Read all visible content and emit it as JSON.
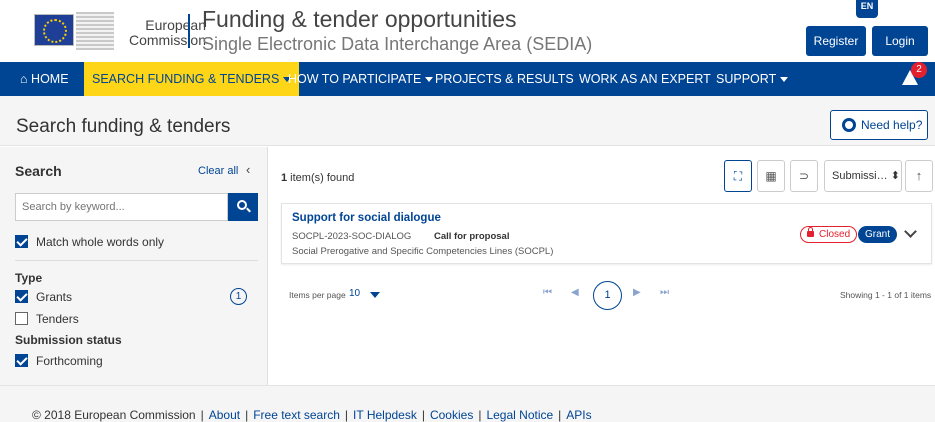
{
  "header": {
    "logo_line1": "European",
    "logo_line2": "Commission",
    "site_title": "Funding & tender opportunities",
    "site_subtitle": "Single Electronic Data Interchange Area (SEDIA)",
    "language": "EN",
    "register_label": "Register",
    "login_label": "Login"
  },
  "nav": {
    "home": "HOME",
    "search": "SEARCH FUNDING & TENDERS",
    "participate": "HOW TO PARTICIPATE",
    "projects": "PROJECTS & RESULTS",
    "expert": "WORK AS AN EXPERT",
    "support": "SUPPORT",
    "alert_count": "2"
  },
  "page": {
    "title": "Search funding & tenders",
    "help_label": "Need help?"
  },
  "sidebar": {
    "heading": "Search",
    "clear_all": "Clear all",
    "collapse_glyph": "‹",
    "search_placeholder": "Search by keyword...",
    "match_whole_words": "Match whole words only",
    "type_heading": "Type",
    "type_options": [
      {
        "label": "Grants",
        "checked": true,
        "count": "1"
      },
      {
        "label": "Tenders",
        "checked": false
      }
    ],
    "status_heading": "Submission status",
    "status_partial": "Forthcoming"
  },
  "results": {
    "count_number": "1",
    "count_label": " item(s) found",
    "sort_label": "Submissi…",
    "sort_arrows": "⬍",
    "sort_dir_glyph": "↑",
    "items": [
      {
        "title": "Support for social dialogue",
        "identifier": "SOCPL-2023-SOC-DIALOG",
        "type": "Call for proposal",
        "programme": "Social Prerogative and Specific Competencies Lines (SOCPL)",
        "status": "Closed",
        "category": "Grant"
      }
    ]
  },
  "pagination": {
    "items_per_page_label": "Items per page",
    "items_per_page_value": "10",
    "first_glyph": "⏮",
    "prev_glyph": "◀",
    "current_page": "1",
    "next_glyph": "▶",
    "last_glyph": "⏭",
    "showing": "Showing 1 - 1 of 1 items"
  },
  "footer": {
    "copyright": "© 2018 European Commission",
    "links": [
      "About",
      "Free text search",
      "IT Helpdesk",
      "Cookies",
      "Legal Notice",
      "APIs"
    ]
  },
  "colors": {
    "primary": "#004494",
    "accent": "#ffd617",
    "closed": "#e4202e"
  },
  "icons": {
    "view_toggle": "⛶",
    "calendar": "▦",
    "rss": "⊃"
  }
}
